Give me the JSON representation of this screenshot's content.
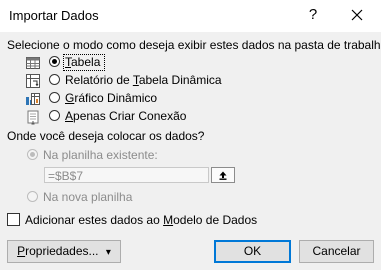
{
  "window": {
    "title": "Importar Dados",
    "help_label": "?"
  },
  "view_section": {
    "prompt": "Selecione o modo como deseja exibir estes dados na pasta de trabalho.",
    "options": [
      {
        "label": "Tabela",
        "accel": "T",
        "rest": "abela",
        "selected": true,
        "icon": "table-icon"
      },
      {
        "label": "Relatório de Tabela Dinâmica",
        "pre": "Relatório de ",
        "accel": "T",
        "rest": "abela Dinâmica",
        "selected": false,
        "icon": "pivot-table-icon"
      },
      {
        "label": "Gráfico Dinâmico",
        "accel": "G",
        "rest": "ráfico Dinâmico",
        "selected": false,
        "icon": "pivot-chart-icon"
      },
      {
        "label": "Apenas Criar Conexão",
        "accel": "A",
        "rest": "penas Criar Conexão",
        "selected": false,
        "icon": "connection-icon"
      }
    ]
  },
  "location_section": {
    "prompt": "Onde você deseja colocar os dados?",
    "existing_sheet": {
      "label": "Na planilha existente:",
      "selected": true,
      "enabled": false
    },
    "reference_value": "=$B$7",
    "new_sheet": {
      "label": "Na nova planilha",
      "selected": false,
      "enabled": false
    }
  },
  "data_model": {
    "pre": "Adicionar estes dados ao ",
    "accel": "M",
    "rest": "odelo de Dados",
    "checked": false
  },
  "buttons": {
    "properties": {
      "accel": "P",
      "rest": "ropriedades...",
      "arrow": "▾"
    },
    "ok": "OK",
    "cancel": "Cancelar"
  },
  "colors": {
    "accent": "#0078d7",
    "dialog_bg": "#f0f0f0"
  }
}
